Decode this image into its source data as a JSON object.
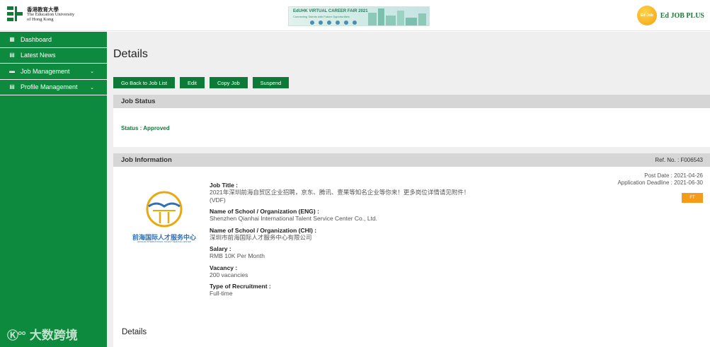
{
  "header": {
    "university_name_zh": "香港教育大學",
    "university_name_en_line1": "The Education University",
    "university_name_en_line2": "of Hong Kong",
    "banner_title": "EdUHK VIRTUAL CAREER FAIR 2021",
    "banner_subtitle": "Connecting Talents with Future Opportunities",
    "jobplus_badge": "Ed Job",
    "jobplus_text": "Ed JOB PLUS"
  },
  "sidebar": {
    "items": [
      {
        "label": "Dashboard",
        "icon": "grid-icon",
        "glyph": "▦",
        "expandable": false
      },
      {
        "label": "Latest News",
        "icon": "document-icon",
        "glyph": "▤",
        "expandable": false
      },
      {
        "label": "Job Management",
        "icon": "briefcase-icon",
        "glyph": "▬",
        "expandable": true
      },
      {
        "label": "Profile Management",
        "icon": "profile-icon",
        "glyph": "▤",
        "expandable": true
      }
    ],
    "watermark": "大数跨境",
    "watermark_glyph": "Ⓚ°°"
  },
  "main": {
    "title": "Details",
    "buttons": {
      "back": "Go Back to Job List",
      "edit": "Edit",
      "copy": "Copy Job",
      "suspend": "Suspend"
    },
    "job_status": {
      "heading": "Job Status",
      "status_text": "Status : Approved"
    },
    "job_info": {
      "heading": "Job Information",
      "ref_label": "Ref. No. :",
      "ref_value": "F006543",
      "post_date_label": "Post Date :",
      "post_date": "2021-04-26",
      "deadline_label": "Application Deadline :",
      "deadline": "2021-06-30",
      "employment_badge": "FT",
      "org_logo_text_zh": "前海国际人才服务中心",
      "org_logo_text_en": "QIANHAI INTERNATIONAL TALENT SERVICE CENTER",
      "fields": [
        {
          "label": "Job Title :",
          "value": "2021年深圳前海自贸区企业招聘，京东、腾讯、壹果等知名企业等你来！更多岗位详情请见附件！",
          "value2": "(VDF)"
        },
        {
          "label": "Name of School / Organization (ENG) :",
          "value": "Shenzhen Qianhai International Talent Service Center Co., Ltd.",
          "value2": ""
        },
        {
          "label": "Name of School / Organization (CHI) :",
          "value": "深圳市前海国际人才服务中心有限公司",
          "value2": ""
        },
        {
          "label": "Salary :",
          "value": "RMB 10K Per Month",
          "value2": ""
        },
        {
          "label": "Vacancy :",
          "value": "200 vacancies",
          "value2": ""
        },
        {
          "label": "Type of Recruitment :",
          "value": "Full-time",
          "value2": ""
        }
      ]
    },
    "details_heading": "Details"
  },
  "colors": {
    "brand_green": "#0e8a3e",
    "button_green": "#0e7a37",
    "badge_orange": "#f49b1a",
    "logo_blue": "#2f6fb5",
    "logo_gold": "#e8a90f"
  }
}
